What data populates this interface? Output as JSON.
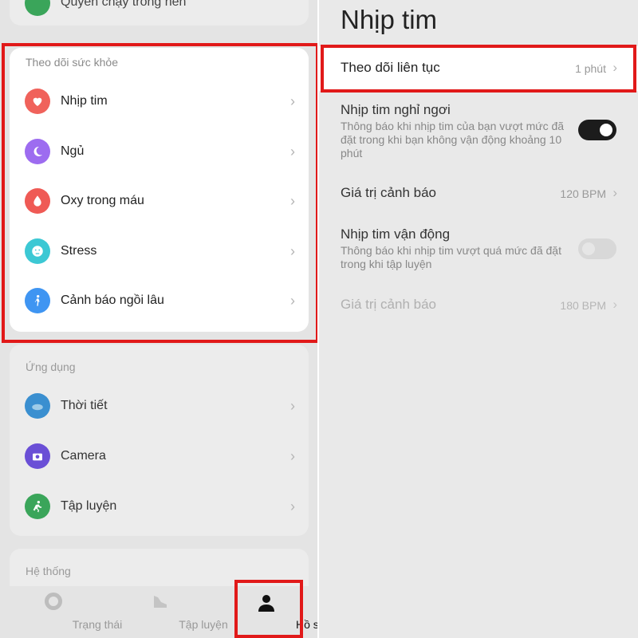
{
  "left": {
    "top_partial_item": "Quyền chạy trong nền",
    "health": {
      "header": "Theo dõi sức khỏe",
      "items": [
        {
          "label": "Nhịp tim",
          "icon": "heart-icon",
          "color": "#f0625b"
        },
        {
          "label": "Ngủ",
          "icon": "moon-icon",
          "color": "#9d6cf0"
        },
        {
          "label": "Oxy trong máu",
          "icon": "blood-drop-icon",
          "color": "#ef5a55"
        },
        {
          "label": "Stress",
          "icon": "face-icon",
          "color": "#3cc8d4"
        },
        {
          "label": "Cảnh báo ngồi lâu",
          "icon": "person-icon",
          "color": "#3f95f2"
        }
      ]
    },
    "apps": {
      "header": "Ứng dụng",
      "items": [
        {
          "label": "Thời tiết",
          "icon": "weather-icon",
          "color": "#3a8fd0"
        },
        {
          "label": "Camera",
          "icon": "camera-icon",
          "color": "#6a4fd6"
        },
        {
          "label": "Tập luyện",
          "icon": "workout-icon",
          "color": "#3aa55a"
        }
      ]
    },
    "system": {
      "header": "Hệ thống"
    },
    "nav": [
      {
        "label": "Trạng thái",
        "icon": "status-icon"
      },
      {
        "label": "Tập luyện",
        "icon": "shoe-icon"
      },
      {
        "label": "Hồ sơ",
        "icon": "profile-icon"
      }
    ]
  },
  "right": {
    "title": "Nhịp tim",
    "continuous": {
      "label": "Theo dõi liên tục",
      "value": "1 phút"
    },
    "resting": {
      "label": "Nhịp tim nghỉ ngơi",
      "desc": "Thông báo khi nhịp tim của bạn vượt mức đã đặt trong khi bạn không vận động khoảng 10 phút",
      "enabled": true
    },
    "resting_alert": {
      "label": "Giá trị cảnh báo",
      "value": "120 BPM"
    },
    "active": {
      "label": "Nhịp tim vận động",
      "desc": "Thông báo khi nhịp tim vượt quá mức đã đặt trong khi tập luyện",
      "enabled": false
    },
    "active_alert": {
      "label": "Giá trị cảnh báo",
      "value": "180 BPM"
    }
  },
  "colors": {
    "highlight": "#e11919"
  }
}
